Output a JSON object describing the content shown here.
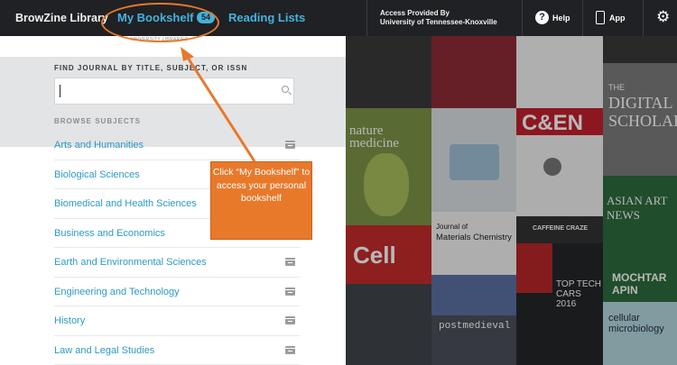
{
  "topbar": {
    "brand": "BrowZine Library",
    "bookshelf_label": "My Bookshelf",
    "bookshelf_count": "54",
    "reading_lists_label": "Reading Lists",
    "access_line1": "Access Provided By",
    "access_line2": "University of Tennessee-Knoxville",
    "help_label": "Help",
    "help_icon_glyph": "?",
    "app_label": "App",
    "settings_icon_glyph": "⚙"
  },
  "panel": {
    "library_logo_text": "UNIVERSITY LIBRARIES",
    "find_label": "FIND JOURNAL BY TITLE, SUBJECT, OR ISSN",
    "search_value": "",
    "browse_label": "BROWSE SUBJECTS",
    "subjects": [
      {
        "label": "Arts and Humanities",
        "bookshelf_icon": true
      },
      {
        "label": "Biological Sciences",
        "bookshelf_icon": false
      },
      {
        "label": "Biomedical and Health Sciences",
        "bookshelf_icon": false
      },
      {
        "label": "Business and Economics",
        "bookshelf_icon": false
      },
      {
        "label": "Earth and Environmental Sciences",
        "bookshelf_icon": true
      },
      {
        "label": "Engineering and Technology",
        "bookshelf_icon": true
      },
      {
        "label": "History",
        "bookshelf_icon": true
      },
      {
        "label": "Law and Legal Studies",
        "bookshelf_icon": true
      }
    ]
  },
  "covers": {
    "nature_medicine": "nature medicine",
    "cell": "Cell",
    "materials_chem_pre": "Journal of",
    "materials_chem": "Materials Chemistry",
    "cen": "C&EN",
    "caffeine": "CAFFEINE CRAZE",
    "top_tech": "TOP TECH CARS 2016",
    "digital_scholar_pre": "THE",
    "digital_scholar": "DIGITAL SCHOLAR",
    "asian_art": "ASIAN ART NEWS",
    "mochtar": "MOCHTAR APIN",
    "cellular_micro": "cellular microbiology",
    "postmedieval": "postmedieval"
  },
  "annotation": {
    "callout_text": "Click “My Bookshelf” to access your personal bookshelf",
    "color": "#e8792b"
  }
}
